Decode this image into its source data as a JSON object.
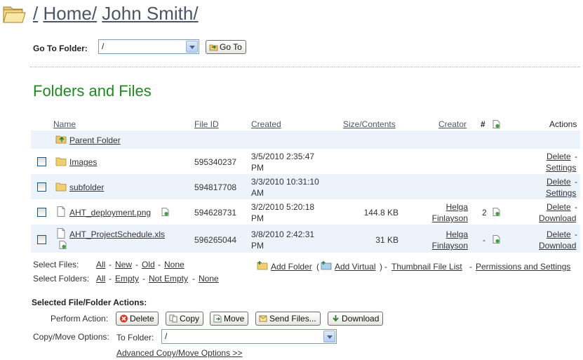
{
  "breadcrumb": {
    "sep1": "/",
    "home": "Home",
    "sep2": "/",
    "user": "John Smith",
    "sep3": "/"
  },
  "goto": {
    "label": "Go To Folder:",
    "value": "/",
    "button": "Go To"
  },
  "section_title": "Folders and Files",
  "columns": {
    "name": "Name",
    "file_id": "File ID",
    "created": "Created",
    "size": "Size/Contents",
    "creator": "Creator",
    "hash": "#",
    "actions": "Actions"
  },
  "parent_folder": "Parent Folder",
  "rows": [
    {
      "name": "Images",
      "file_id": "595340237",
      "created_1": "3/5/2010 2:35:47",
      "created_2": "PM",
      "size": "",
      "creator_1": "",
      "creator_2": "",
      "count": "",
      "action_1": "Delete",
      "action_sep": "-",
      "action_2": "Settings"
    },
    {
      "name": "subfolder",
      "file_id": "594817708",
      "created_1": "3/3/2010 10:31:10",
      "created_2": "AM",
      "size": "",
      "creator_1": "",
      "creator_2": "",
      "count": "",
      "action_1": "Delete",
      "action_sep": "-",
      "action_2": "Settings"
    },
    {
      "name": "AHT_deployment.png",
      "file_id": "594628731",
      "created_1": "3/2/2010 5:20:18",
      "created_2": "PM",
      "size": "144.8 KB",
      "creator_1": "Helga",
      "creator_2": "Finlayson",
      "count": "2",
      "action_1": "Delete",
      "action_sep": "-",
      "action_2": "Download"
    },
    {
      "name": "AHT_ProjectSchedule.xls",
      "file_id": "596265044",
      "created_1": "3/8/2010 2:42:31",
      "created_2": "PM",
      "size": "31 KB",
      "creator_1": "Helga",
      "creator_2": "Finlayson",
      "count": "-",
      "action_1": "Delete",
      "action_sep": "-",
      "action_2": "Download"
    }
  ],
  "select_files": {
    "label": "Select Files:",
    "all": "All",
    "new": "New",
    "old": "Old",
    "none": "None",
    "sep": "-"
  },
  "select_folders": {
    "label": "Select Folders:",
    "all": "All",
    "empty": "Empty",
    "not_empty": "Not Empty",
    "none": "None",
    "sep": "-"
  },
  "links": {
    "add_folder": "Add Folder",
    "open_paren": "(",
    "add_virtual": "Add Virtual",
    "close_paren": ")",
    "sep": "-",
    "thumbnail": "Thumbnail File List",
    "permissions": "Permissions and Settings"
  },
  "actions": {
    "heading": "Selected File/Folder Actions:",
    "perform_label": "Perform Action:",
    "delete": "Delete",
    "copy": "Copy",
    "move": "Move",
    "send": "Send Files...",
    "download": "Download",
    "copymove_label": "Copy/Move Options:",
    "to_folder_label": "To Folder:",
    "to_folder_value": "/",
    "advanced": "Advanced Copy/Move Options >>"
  },
  "icons": {
    "header": "open-folder-icon",
    "folder": "folder-icon",
    "document": "document-icon",
    "parent": "parent-folder-icon"
  },
  "colors": {
    "title_green": "#1f8a1f",
    "link": "#4a5566",
    "row_alt": "#edf3fb"
  }
}
